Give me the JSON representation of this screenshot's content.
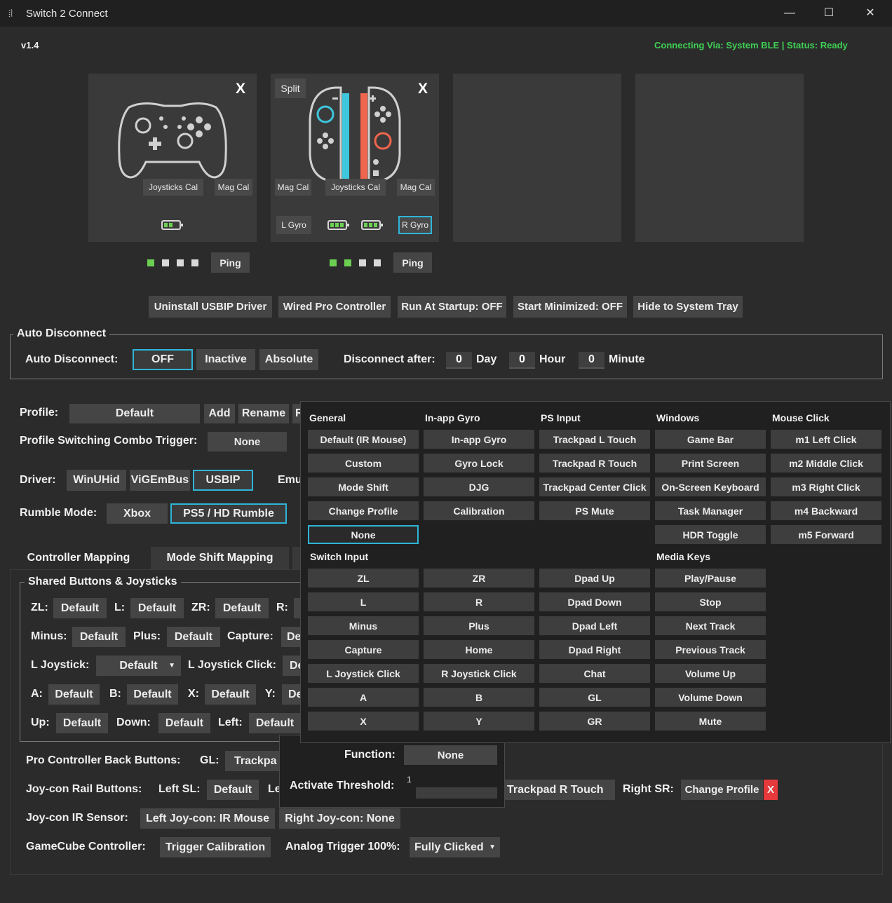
{
  "window": {
    "title": "Switch 2 Connect",
    "minimize": "—",
    "maximize": "☐",
    "close": "✕"
  },
  "header": {
    "version": "v1.4",
    "connection": "Connecting Via: System BLE  |  Status: Ready",
    "status_color": "#3fd155"
  },
  "slots": {
    "slot1": {
      "close": "X",
      "joysticks_cal": "Joysticks Cal",
      "mag_cal": "Mag Cal",
      "ping": "Ping"
    },
    "slot2": {
      "split": "Split",
      "close": "X",
      "mag_cal_left": "Mag Cal",
      "joysticks_cal": "Joysticks Cal",
      "mag_cal_right": "Mag Cal",
      "l_gyro": "L Gyro",
      "r_gyro": "R Gyro",
      "ping": "Ping"
    }
  },
  "toolbar": {
    "uninstall": "Uninstall USBIP Driver",
    "wired": "Wired Pro Controller",
    "startup": "Run At Startup: OFF",
    "minimized": "Start Minimized: OFF",
    "tray": "Hide to System Tray"
  },
  "auto_disconnect": {
    "group_title": "Auto Disconnect",
    "label": "Auto Disconnect:",
    "options": [
      "OFF",
      "Inactive",
      "Absolute"
    ],
    "selected": "OFF",
    "after_label": "Disconnect after:",
    "day_value": "0",
    "day_label": "Day",
    "hour_value": "0",
    "hour_label": "Hour",
    "minute_value": "0",
    "minute_label": "Minute"
  },
  "profile": {
    "label": "Profile:",
    "value": "Default",
    "add": "Add",
    "rename": "Rename",
    "cut": "R",
    "combo_label": "Profile Switching Combo Trigger:",
    "combo_value": "None"
  },
  "driver": {
    "label": "Driver:",
    "options": [
      "WinUHid",
      "ViGEmBus",
      "USBIP"
    ],
    "selected": "USBIP",
    "emu_label": "Emu"
  },
  "rumble": {
    "label": "Rumble Mode:",
    "options": [
      "Xbox",
      "PS5 / HD Rumble"
    ],
    "selected": "PS5 / HD Rumble"
  },
  "tabs": {
    "controller_mapping": "Controller Mapping",
    "mode_shift_mapping": "Mode Shift Mapping"
  },
  "shared": {
    "group_title": "Shared Buttons & Joysticks",
    "zl_label": "ZL:",
    "zl": "Default",
    "l_label": "L:",
    "l": "Default",
    "zr_label": "ZR:",
    "zr": "Default",
    "r_label": "R:",
    "minus_label": "Minus:",
    "minus": "Default",
    "plus_label": "Plus:",
    "plus": "Default",
    "capture_label": "Capture:",
    "capture": "De",
    "ljoy_label": "L Joystick:",
    "ljoy": "Default",
    "ljoyclick_label": "L Joystick Click:",
    "ljoyclick": "De",
    "a_label": "A:",
    "a": "Default",
    "b_label": "B:",
    "b": "Default",
    "x_label": "X:",
    "x": "Default",
    "y_label": "Y:",
    "y": "De",
    "up_label": "Up:",
    "up": "Default",
    "down_label": "Down:",
    "down": "Default",
    "left_label": "Left:",
    "left": "Default"
  },
  "bottom": {
    "back_label": "Pro Controller Back Buttons:",
    "gl_label": "GL:",
    "gl": "Trackpa",
    "rail_label": "Joy-con Rail Buttons:",
    "leftsl_label": "Left SL:",
    "leftsl": "Default",
    "le_cut": "Le",
    "trackpad_r": "Trackpad R Touch",
    "rightsr_label": "Right SR:",
    "rightsr": "Change Profile",
    "rightsr_clear": "X",
    "ir_label": "Joy-con IR Sensor:",
    "ir_left": "Left Joy-con: IR Mouse",
    "ir_right": "Right Joy-con: None",
    "gc_label": "GameCube Controller:",
    "gc_trigger": "Trigger Calibration",
    "analog_label": "Analog Trigger 100%:",
    "analog_value": "Fully Clicked"
  },
  "function_popup": {
    "function_label": "Function:",
    "function_value": "None",
    "threshold_label": "Activate Threshold:",
    "threshold_value": "1"
  },
  "menu": {
    "general": {
      "title": "General",
      "items": [
        "Default (IR Mouse)",
        "Custom",
        "Mode Shift",
        "Change Profile",
        "None"
      ]
    },
    "inapp": {
      "title": "In-app Gyro",
      "items": [
        "In-app Gyro",
        "Gyro Lock",
        "DJG",
        "Calibration"
      ]
    },
    "ps": {
      "title": "PS Input",
      "items": [
        "Trackpad L Touch",
        "Trackpad R Touch",
        "Trackpad Center Click",
        "PS Mute"
      ]
    },
    "windows": {
      "title": "Windows",
      "items": [
        "Game Bar",
        "Print Screen",
        "On-Screen Keyboard",
        "Task Manager",
        "HDR Toggle"
      ]
    },
    "mouse": {
      "title": "Mouse Click",
      "items": [
        "m1 Left Click",
        "m2 Middle Click",
        "m3 Right Click",
        "m4 Backward",
        "m5 Forward"
      ]
    },
    "switch": {
      "title": "Switch Input",
      "col1": [
        "ZL",
        "L",
        "Minus",
        "Capture",
        "L Joystick Click",
        "A",
        "X"
      ],
      "col2": [
        "ZR",
        "R",
        "Plus",
        "Home",
        "R Joystick Click",
        "B",
        "Y"
      ],
      "col3": [
        "Dpad Up",
        "Dpad Down",
        "Dpad Left",
        "Dpad Right",
        "Chat",
        "GL",
        "GR"
      ]
    },
    "media": {
      "title": "Media Keys",
      "items": [
        "Play/Pause",
        "Stop",
        "Next Track",
        "Previous Track",
        "Volume Up",
        "Volume Down",
        "Mute"
      ]
    }
  },
  "colors": {
    "accent": "#2fb4d8",
    "joycon_left": "#3ec6dc",
    "joycon_right": "#f0654d",
    "player_led_on": "#6bd052",
    "player_led_off": "#d9d9d9",
    "clear_red": "#e5393c"
  }
}
